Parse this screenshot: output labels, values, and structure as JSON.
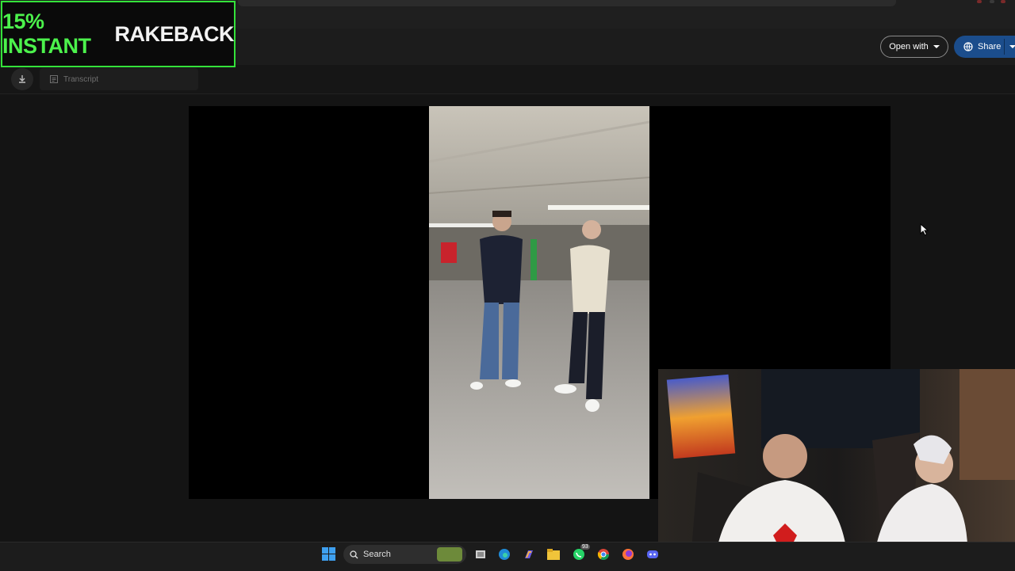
{
  "overlay": {
    "promo_accent": "15% INSTANT",
    "promo_rest": "RAKEBACK",
    "accent_color": "#4cf24c"
  },
  "drive": {
    "open_with_label": "Open with",
    "share_label": "Share",
    "transcript_label": "Transcript"
  },
  "taskbar": {
    "search_label": "Search",
    "whatsapp_badge": "93",
    "icons": [
      "windows-start-icon",
      "search-icon",
      "task-view-icon",
      "edge-icon",
      "copilot-icon",
      "file-explorer-icon",
      "whatsapp-icon",
      "chrome-icon",
      "firefox-icon",
      "discord-icon"
    ]
  },
  "colors": {
    "share_bg": "#1b4d8c",
    "promo_border": "#34e23a",
    "page_bg": "#141414"
  }
}
